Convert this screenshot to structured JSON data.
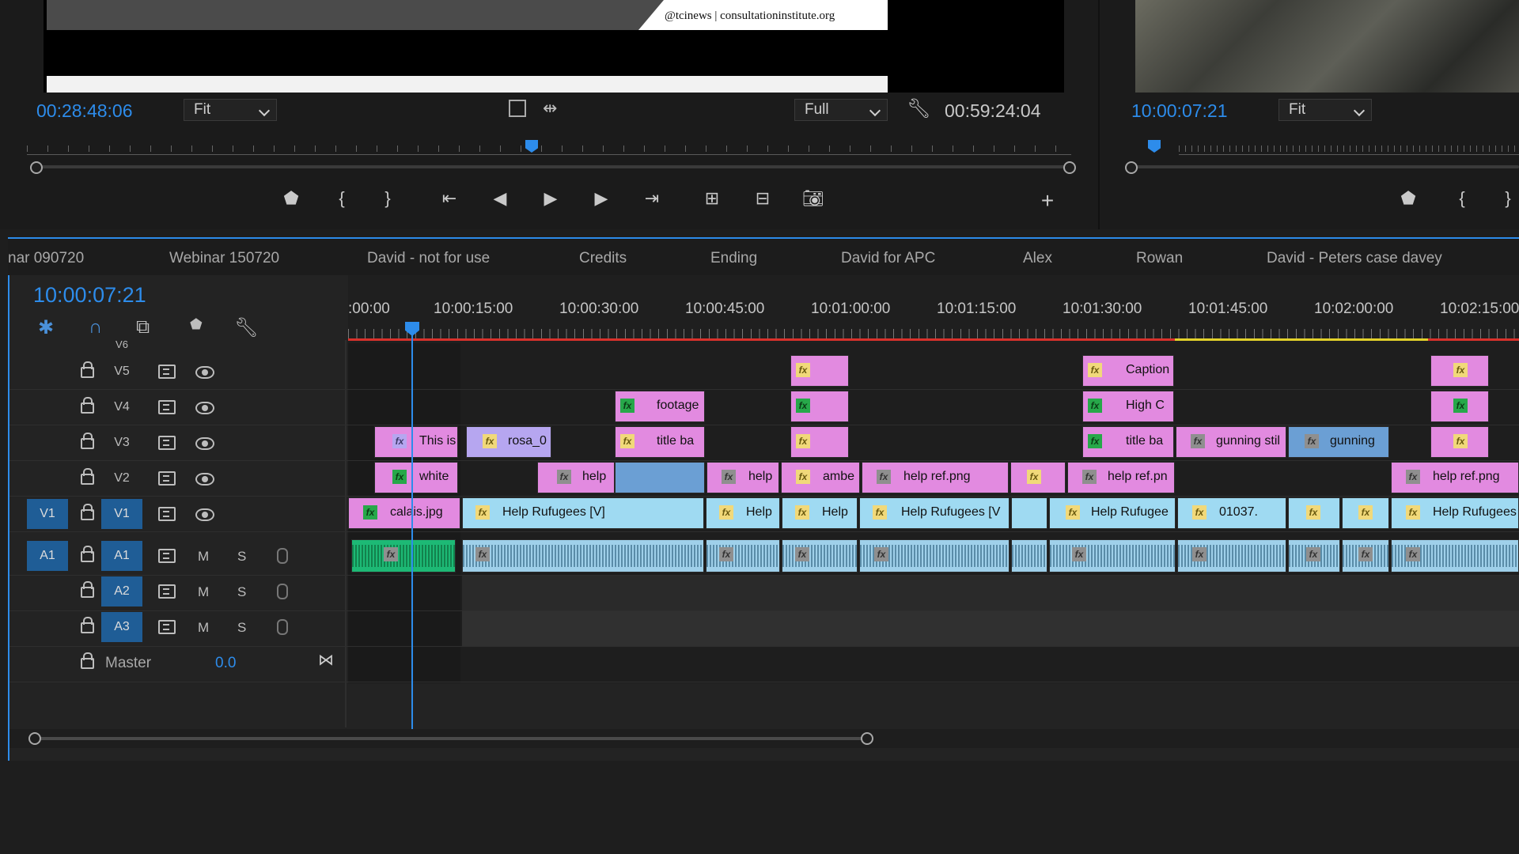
{
  "source_monitor": {
    "overlay_text": "@tcinews | consultationinstitute.org",
    "timecode_in": "00:28:48:06",
    "zoom": "Fit",
    "resolution": "Full",
    "timecode_duration": "00:59:24:04"
  },
  "program_monitor": {
    "timecode": "10:00:07:21",
    "zoom": "Fit"
  },
  "timeline": {
    "tabs": [
      "nar 090720",
      "Webinar 150720",
      "David - not for use",
      "Credits",
      "Ending",
      "David for APC",
      "Alex",
      "Rowan",
      "David - Peters case davey"
    ],
    "current_time": "10:00:07:21",
    "ruler_times": [
      ":00:00",
      "10:00:15:00",
      "10:00:30:00",
      "10:00:45:00",
      "10:01:00:00",
      "10:01:15:00",
      "10:01:30:00",
      "10:01:45:00",
      "10:02:00:00",
      "10:02:15:00"
    ],
    "tracks": {
      "v6": "V6",
      "v5": "V5",
      "v4": "V4",
      "v3": "V3",
      "v2": "V2",
      "v1": "V1",
      "a1": "A1",
      "a2": "A2",
      "a3": "A3",
      "src_v1": "V1",
      "src_a1": "A1",
      "m": "M",
      "s": "S",
      "master": "Master",
      "master_value": "0.0"
    },
    "clips": {
      "v5": [
        "Caption"
      ],
      "v4": [
        "footage",
        "High C"
      ],
      "v3": [
        "This is",
        "rosa_0",
        "title ba",
        "title ba",
        "gunning stil",
        "gunning"
      ],
      "v2": [
        "white",
        "help",
        "help",
        "ambe",
        "help ref.png",
        "help ref.pn",
        "help ref.png"
      ],
      "v1": [
        "calais.jpg",
        "Help Rufugees [V]",
        "Help",
        "Help",
        "Help Rufugees [V",
        "Help Rufugee",
        "01037.",
        "Help Rufugees"
      ]
    },
    "fx_badge": "fx"
  },
  "icons": {
    "source_transport": [
      "marker-icon",
      "mark-in-icon",
      "mark-out-icon",
      "go-to-in-icon",
      "step-back-icon",
      "play-icon",
      "step-forward-icon",
      "go-to-out-icon",
      "insert-icon",
      "overwrite-icon",
      "export-frame-icon",
      "add-button-icon"
    ]
  },
  "colors": {
    "accent": "#2d8ceb",
    "clip_pink": "#e28ae0",
    "clip_cyan": "#9fdaf2",
    "clip_lavender": "#b6a6f0",
    "audio_green": "#1db975",
    "render_red": "#d9312b",
    "render_yellow": "#e2d12a"
  }
}
